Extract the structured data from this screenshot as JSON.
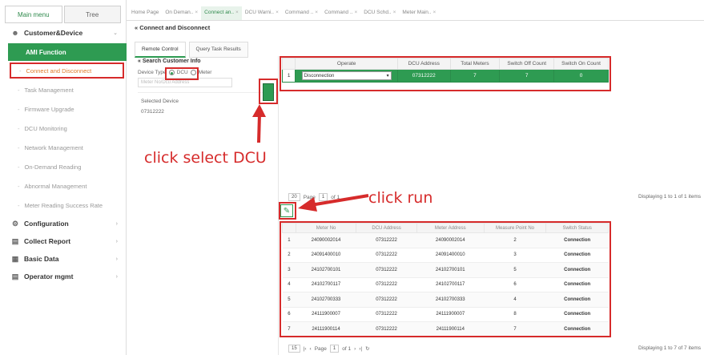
{
  "sidebar": {
    "tabs": [
      "Main menu",
      "Tree"
    ],
    "sections": [
      {
        "label": "Customer&Device",
        "icon": "user-icon"
      }
    ],
    "selected": "AMI Function",
    "items": [
      "Connect and Disconnect",
      "Task Management",
      "Firmware Upgrade",
      "DCU Monitoring",
      "Network Management",
      "On-Demand Reading",
      "Abnormal Management",
      "Meter Reading Success Rate"
    ],
    "bottom_sections": [
      {
        "label": "Configuration",
        "icon": "gear-icon"
      },
      {
        "label": "Collect Report",
        "icon": "report-icon"
      },
      {
        "label": "Basic Data",
        "icon": "data-icon"
      },
      {
        "label": "Operator mgmt",
        "icon": "operator-icon"
      }
    ]
  },
  "topbar": {
    "tabs": [
      "Home Page",
      "On Deman..",
      "Connect an..",
      "DCU Warni..",
      "Command ..",
      "Command ..",
      "DCU Schd..",
      "Meter Main.."
    ]
  },
  "page_title": "Connect and Disconnect",
  "content_tabs": [
    "Remote Control",
    "Query Task Results"
  ],
  "search": {
    "heading": "Search Customer Info",
    "device_type_label": "Device Type",
    "option_dcu": "DCU",
    "option_meter": "Meter",
    "placeholder": "Meter No/Dcu Address",
    "selected_label": "Selected Device",
    "selected_value": "07312222"
  },
  "grid1": {
    "headers": [
      "Operate",
      "DCU Address",
      "Total Meters",
      "Switch Off Count",
      "Switch On Count"
    ],
    "rows": [
      {
        "num": "1",
        "operate": "Disconnection",
        "dcu": "07312222",
        "total": "7",
        "off": "7",
        "on": "0"
      }
    ]
  },
  "pager1": {
    "size": "20",
    "page_label": "Page",
    "page": "1",
    "of": "of 1",
    "display": "Displaying 1 to 1 of 1 items"
  },
  "annotations": {
    "select_dcu": "click select DCU",
    "run": "click run"
  },
  "grid2": {
    "headers": [
      "Meter No",
      "DCU Address",
      "Meter Address",
      "Measure Point No",
      "Switch Status"
    ],
    "rows": [
      [
        "1",
        "24090002014",
        "07312222",
        "24090002014",
        "2",
        "Connection"
      ],
      [
        "2",
        "24091400010",
        "07312222",
        "24091400010",
        "3",
        "Connection"
      ],
      [
        "3",
        "24102700101",
        "07312222",
        "24102700101",
        "5",
        "Connection"
      ],
      [
        "4",
        "24102700117",
        "07312222",
        "24102700117",
        "6",
        "Connection"
      ],
      [
        "5",
        "24102700333",
        "07312222",
        "24102700333",
        "4",
        "Connection"
      ],
      [
        "6",
        "24111900007",
        "07312222",
        "24111900007",
        "8",
        "Connection"
      ],
      [
        "7",
        "24111900114",
        "07312222",
        "24111900114",
        "7",
        "Connection"
      ]
    ]
  },
  "pager2": {
    "size": "15",
    "page_label": "Page",
    "page": "1",
    "of": "of 1",
    "display": "Displaying 1 to 7 of 7 items"
  }
}
